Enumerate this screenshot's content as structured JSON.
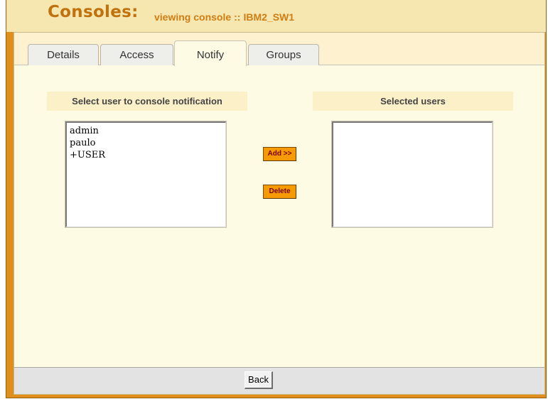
{
  "header": {
    "title": "Consoles:",
    "subtitle_prefix": "viewing console",
    "separator": "::",
    "console_name": "IBM2_SW1"
  },
  "tabs": [
    {
      "label": "Details",
      "active": false
    },
    {
      "label": "Access",
      "active": false
    },
    {
      "label": "Notify",
      "active": true
    },
    {
      "label": "Groups",
      "active": false
    }
  ],
  "notify": {
    "available_heading": "Select user to console notification",
    "selected_heading": "Selected users",
    "available_users": [
      "admin",
      "paulo",
      "+USER"
    ],
    "selected_users": [],
    "add_label": "Add >>",
    "delete_label": "Delete"
  },
  "footer": {
    "back_label": "Back"
  },
  "colors": {
    "frame": "#e08e1c",
    "header_bg": "#f6e6b0",
    "title": "#c0720e",
    "panel_bg": "#fefbe5",
    "action_button": "#f59a00"
  }
}
